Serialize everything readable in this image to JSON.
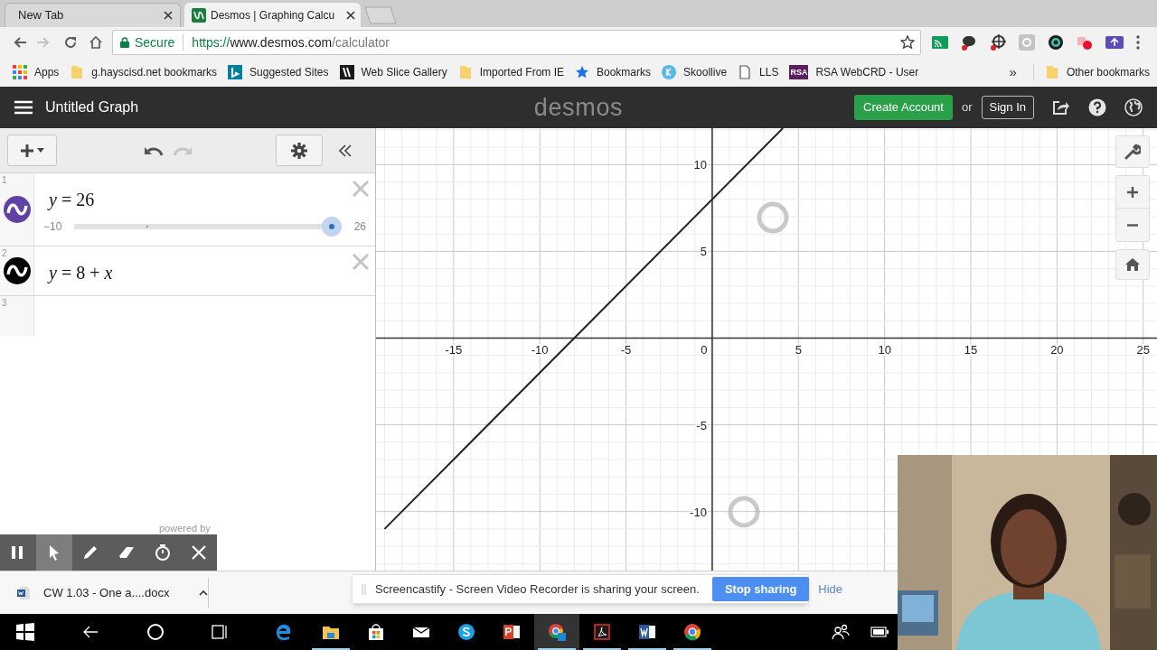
{
  "browser": {
    "tabs": [
      {
        "kind": "blank",
        "title": "New Tab",
        "selected": false
      },
      {
        "kind": "site",
        "title": "Desmos | Graphing Calcu",
        "selected": true
      }
    ],
    "address": {
      "secure_label": "Secure",
      "scheme": "https://",
      "host": "www.desmos.com",
      "path": "/calculator"
    },
    "bookmarks": [
      {
        "kind": "apps",
        "label": "Apps"
      },
      {
        "kind": "folder",
        "label": "g.hayscisd.net bookmarks"
      },
      {
        "kind": "bing",
        "label": "Suggested Sites"
      },
      {
        "kind": "webslice",
        "label": "Web Slice Gallery"
      },
      {
        "kind": "folder",
        "label": "Imported From IE"
      },
      {
        "kind": "star",
        "label": "Bookmarks"
      },
      {
        "kind": "skoollive",
        "label": "Skoollive"
      },
      {
        "kind": "page",
        "label": "LLS"
      },
      {
        "kind": "rsa",
        "badge": "RSA",
        "label": "RSA WebCRD - User"
      }
    ],
    "more": "»",
    "other_bookmarks": "Other bookmarks"
  },
  "calculator": {
    "title": "Untitled Graph",
    "logo": "desmos",
    "create_account": "Create Account",
    "or": "or",
    "sign_in": "Sign In",
    "expressions": [
      {
        "index": "1",
        "latex": "*y* = 26",
        "color": "#6042a6",
        "slider": {
          "min": "−10",
          "max": "26",
          "level": 1
        }
      },
      {
        "index": "2",
        "latex": "*y* = 8 + *x*",
        "color": "#000000"
      }
    ],
    "next_index": "3",
    "origin_label": "0",
    "graph": {
      "chart_data": {
        "type": "line",
        "x": [
          -19,
          4.1
        ],
        "series": [
          {
            "color": "#222222",
            "values": [
              -11,
              12.1
            ]
          }
        ],
        "xlim": [
          -19.5,
          25.8
        ],
        "ylim": [
          -13.4,
          12.1
        ],
        "xticks": [
          -15,
          -10,
          -5,
          5,
          10,
          15,
          20,
          25
        ],
        "yticks": [
          -10,
          -5,
          5,
          10
        ],
        "grid": true
      }
    }
  },
  "recorder": {
    "powered_by": "powered by",
    "tools": [
      {
        "kind": "pause",
        "selected": false
      },
      {
        "kind": "pointer",
        "selected": true
      },
      {
        "kind": "pen",
        "selected": false
      },
      {
        "kind": "eraser",
        "selected": false
      },
      {
        "kind": "timer",
        "selected": false
      },
      {
        "kind": "close",
        "selected": false
      }
    ]
  },
  "downloads": [
    {
      "name": "CW 1.03 - One a....docx"
    }
  ],
  "share_notice": {
    "message": "Screencastify - Screen Video Recorder is sharing your screen.",
    "stop": "Stop sharing",
    "hide": "Hide"
  },
  "taskbar": {
    "items": [
      {
        "kind": "start",
        "running": false,
        "selected": false
      },
      {
        "kind": "back",
        "running": false,
        "selected": false
      },
      {
        "kind": "search",
        "running": false,
        "selected": false
      },
      {
        "kind": "task_view",
        "running": false,
        "selected": false
      },
      {
        "kind": "edge",
        "running": false,
        "selected": false
      },
      {
        "kind": "explorer",
        "running": true,
        "selected": false
      },
      {
        "kind": "store",
        "running": false,
        "selected": false
      },
      {
        "kind": "mail",
        "running": false,
        "selected": false
      },
      {
        "kind": "skype",
        "running": false,
        "selected": false
      },
      {
        "kind": "powerpoint",
        "running": false,
        "selected": false
      },
      {
        "kind": "chrome_app",
        "running": true,
        "selected": true
      },
      {
        "kind": "acrobat",
        "running": true,
        "selected": false
      },
      {
        "kind": "word",
        "running": true,
        "selected": false
      },
      {
        "kind": "chrome",
        "running": true,
        "selected": false
      }
    ]
  }
}
